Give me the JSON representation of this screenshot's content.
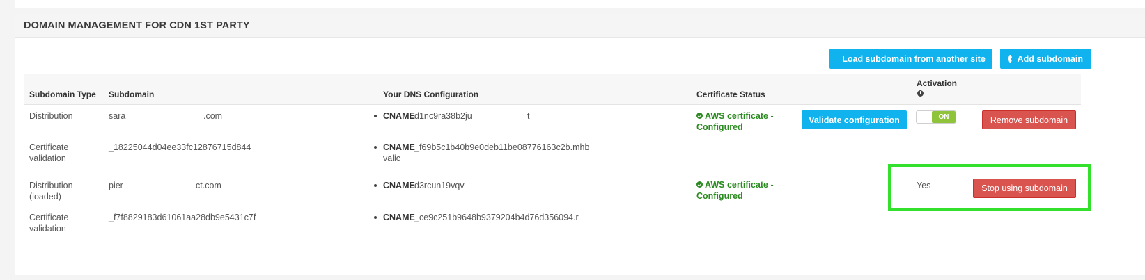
{
  "panel": {
    "title": "DOMAIN MANAGEMENT FOR CDN 1ST PARTY"
  },
  "toolbar": {
    "load_label": "Load subdomain from another site",
    "add_label": "Add subdomain"
  },
  "table": {
    "headers": {
      "type": "Subdomain Type",
      "subdomain": "Subdomain",
      "dns": "Your DNS Configuration",
      "cert": "Certificate Status",
      "activation": "Activation"
    },
    "rows": [
      {
        "type": "Distribution",
        "subdomain_start": "sara",
        "subdomain_end": ".com",
        "dns_kind": "CNAME",
        "dns_value": "d1nc9ra38b2ju",
        "dns_value_end": "t",
        "cert_status": "AWS certificate - Configured",
        "validate_label": "Validate configuration",
        "toggle_label": "ON",
        "action_label": "Remove subdomain"
      },
      {
        "type": "Certificate validation",
        "subdomain_start": "_18225044d04ee33fc12876715d844",
        "subdomain_end": "",
        "dns_kind": "CNAME",
        "dns_value": "_f69b5c1b40b9e0deb11be08776163c2b.mhb",
        "dns_value_line2": "valic"
      },
      {
        "type": "Distribution (loaded)",
        "subdomain_start": "pier",
        "subdomain_end": "ct.com",
        "dns_kind": "CNAME",
        "dns_value": "d3rcun19vqv",
        "cert_status": "AWS certificate - Configured",
        "activation_text": "Yes",
        "action_label": "Stop using subdomain"
      },
      {
        "type": "Certificate validation",
        "subdomain_start": "_f7f8829183d61061aa28db9e5431c7f",
        "subdomain_end": "",
        "dns_kind": "CNAME",
        "dns_value": "_ce9c251b9648b9379204b4d76d356094.r"
      }
    ]
  },
  "icons": {
    "plus": "plus-circle-icon",
    "check": "check-circle-icon",
    "info": "info-circle-icon"
  },
  "colors": {
    "accent_blue": "#10b3ed",
    "danger_red": "#d9534f",
    "success_green": "#2a8a1f",
    "toggle_green": "#8fc43a",
    "highlight_green": "#33e02c"
  }
}
